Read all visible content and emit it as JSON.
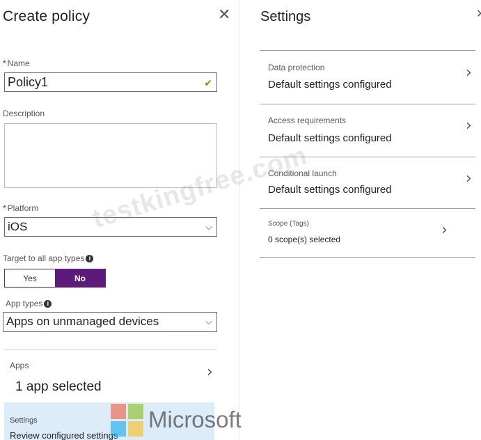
{
  "create_policy": {
    "title": "Create policy",
    "close_glyph": "✕",
    "name": {
      "label": "Name",
      "required_mark": "*",
      "value": "Policy1",
      "valid_mark": "✔"
    },
    "description": {
      "label": "Description",
      "value": ""
    },
    "platform": {
      "label": "Platform",
      "required_mark": "*",
      "value": "iOS",
      "chevron": "⌵"
    },
    "target_all": {
      "label": "Target to all app types",
      "info": "i",
      "options": [
        "Yes",
        "No"
      ],
      "selected": "No"
    },
    "app_types": {
      "label": "App types",
      "info": "i",
      "value": "Apps on unmanaged devices",
      "chevron": "⌵"
    },
    "apps": {
      "label": "Apps",
      "value": "1 app selected",
      "chevron": "›"
    },
    "settings": {
      "label": "Settings",
      "value": "Review configured settings"
    }
  },
  "settings_blade": {
    "title": "Settings",
    "close_glyph": "✕",
    "items": [
      {
        "label": "Data protection",
        "value": "Default settings configured",
        "chevron": "›"
      },
      {
        "label": "Access requirements",
        "value": "Default settings configured",
        "chevron": "›"
      },
      {
        "label": "Conditional launch",
        "value": "Default settings configured",
        "chevron": "›"
      },
      {
        "label": "Scope (Tags)",
        "value": "0 scope(s) selected",
        "chevron": "›"
      }
    ]
  },
  "watermark": {
    "site": "testkingfree.com",
    "brand": "Microsoft"
  },
  "colors": {
    "toggle_on": "#5c1a7a",
    "valid_check": "#5fa300",
    "settings_row_bg": "#dcecf8"
  },
  "icons": [
    "close-icon",
    "check-icon",
    "chevron-down-icon",
    "info-icon",
    "chevron-right-icon",
    "microsoft-logo"
  ]
}
